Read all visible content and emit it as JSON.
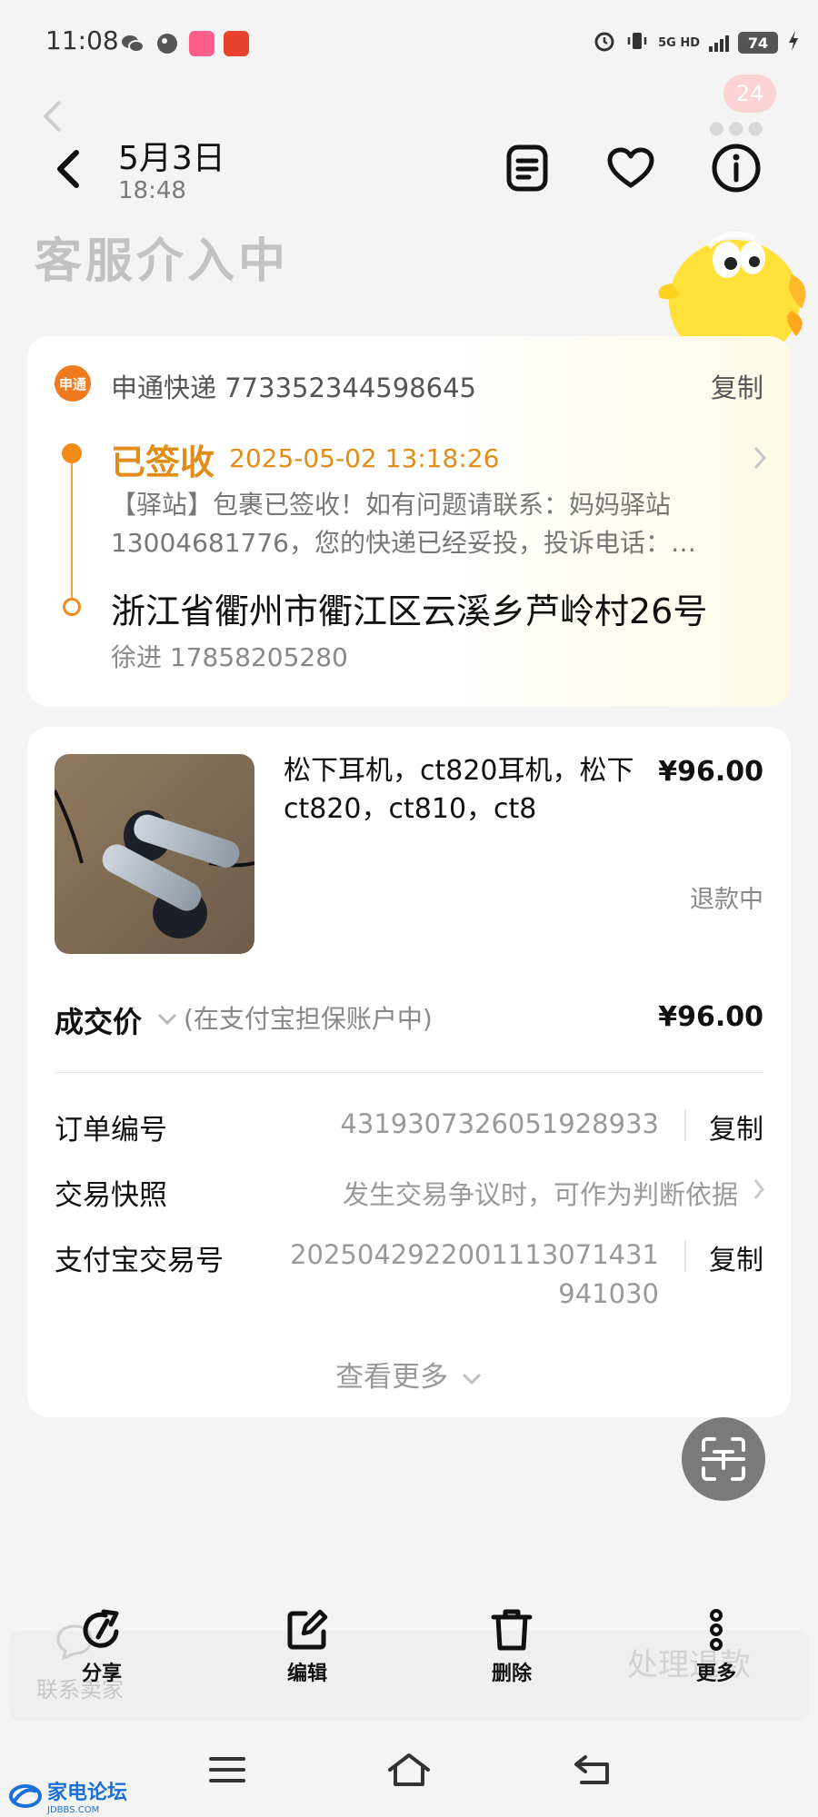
{
  "status_bar": {
    "time": "11:08",
    "network": "5G HD",
    "battery": "74"
  },
  "background": {
    "title": "客服介入中",
    "badge_count": "24",
    "contact_seller": "联系卖家",
    "process_label": "处理退款"
  },
  "header": {
    "date": "5月3日",
    "time": "18:48",
    "icons": [
      "note-icon",
      "heart-icon",
      "info-icon"
    ]
  },
  "logistics": {
    "courier_logo": "申通",
    "courier_text": "申通快递 773352344598645",
    "copy_label": "复制",
    "status": "已签收",
    "status_time": "2025-05-02 13:18:26",
    "description": "【驿站】包裹已签收！如有问题请联系：妈妈驿站13004681776，您的快递已经妥投，投诉电话：…",
    "address": "浙江省衢州市衢江区云溪乡芦岭村26号",
    "contact": "徐进 17858205280"
  },
  "order": {
    "product_title": "松下耳机，ct820耳机，松下ct820，ct810，ct8",
    "product_price": "¥96.00",
    "refund_status": "退款中",
    "deal_label": "成交价",
    "deal_note": "(在支付宝担保账户中)",
    "deal_price": "¥96.00",
    "rows": [
      {
        "label": "订单编号",
        "value": "4319307326051928933",
        "action": "复制"
      },
      {
        "label": "交易快照",
        "value": "发生交易争议时，可作为判断依据",
        "action": ""
      },
      {
        "label": "支付宝交易号",
        "value_line1": "2025042922001113071431",
        "value_line2": "941030",
        "action": "复制"
      }
    ],
    "more_label": "查看更多"
  },
  "actions": [
    {
      "label": "分享",
      "icon": "share-icon"
    },
    {
      "label": "编辑",
      "icon": "edit-icon"
    },
    {
      "label": "删除",
      "icon": "trash-icon"
    },
    {
      "label": "更多",
      "icon": "more-icon"
    }
  ],
  "watermark": {
    "name": "家电论坛",
    "domain": "JDBBS.COM"
  },
  "colors": {
    "accent": "#e28d1a",
    "background": "#f4f4f5",
    "text": "#111111",
    "muted": "#888888"
  }
}
